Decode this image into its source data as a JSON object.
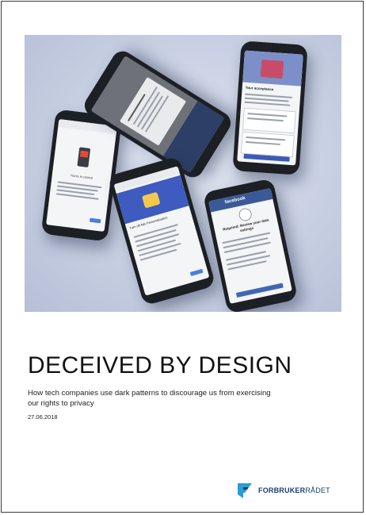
{
  "cover": {
    "title": "DECEIVED BY DESIGN",
    "subtitle": "How tech companies use dark patterns to discourage us from exercising our rights to privacy",
    "date": "27.06.2018"
  },
  "brand": {
    "name_bold": "FORBRUKER",
    "name_light": "RÅDET",
    "color": "#1a3d73",
    "accent": "#2c9bd6"
  },
  "phones": {
    "p1_heading": "You're in control",
    "p3_heading": "Your acceptance",
    "p4_heading": "Turn off Ads Personalization",
    "p5_app": "facebook",
    "p5_heading": "Required: Review your data settings"
  }
}
